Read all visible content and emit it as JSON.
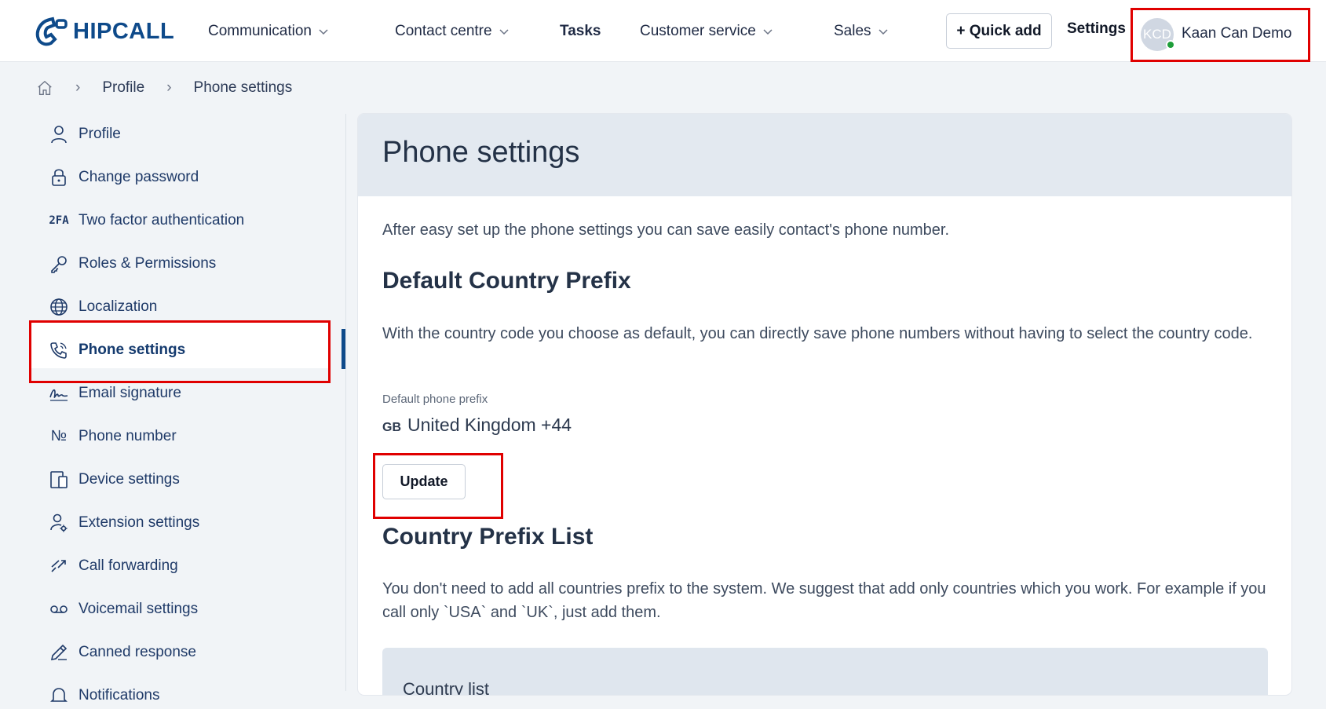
{
  "app": {
    "logo_text": "HIPCALL"
  },
  "nav": {
    "items": [
      {
        "label": "Communication",
        "has_dropdown": true
      },
      {
        "label": "Contact centre",
        "has_dropdown": true
      },
      {
        "label": "Tasks",
        "has_dropdown": false
      },
      {
        "label": "Customer service",
        "has_dropdown": true
      },
      {
        "label": "Sales",
        "has_dropdown": true
      }
    ],
    "quick_add": "+ Quick add",
    "settings": "Settings",
    "user": {
      "initials": "KCD",
      "name": "Kaan Can Demo",
      "status_color": "#1e9e3a"
    }
  },
  "breadcrumb": {
    "items": [
      "Profile",
      "Phone settings"
    ]
  },
  "sidebar": {
    "items": [
      {
        "label": "Profile",
        "icon": "user-icon"
      },
      {
        "label": "Change password",
        "icon": "lock-icon"
      },
      {
        "label": "Two factor authentication",
        "icon": "2fa-icon",
        "icon_text": "2FA"
      },
      {
        "label": "Roles & Permissions",
        "icon": "key-icon"
      },
      {
        "label": "Localization",
        "icon": "globe-icon"
      },
      {
        "label": "Phone settings",
        "icon": "phone-icon",
        "active": true
      },
      {
        "label": "Email signature",
        "icon": "signature-icon"
      },
      {
        "label": "Phone number",
        "icon": "numero-icon",
        "icon_text": "№"
      },
      {
        "label": "Device settings",
        "icon": "devices-icon"
      },
      {
        "label": "Extension settings",
        "icon": "user-gear-icon"
      },
      {
        "label": "Call forwarding",
        "icon": "forward-icon"
      },
      {
        "label": "Voicemail settings",
        "icon": "voicemail-icon"
      },
      {
        "label": "Canned response",
        "icon": "pen-icon"
      },
      {
        "label": "Notifications",
        "icon": "bell-icon"
      }
    ]
  },
  "main": {
    "title": "Phone settings",
    "intro": "After easy set up the phone settings you can save easily contact's phone number.",
    "default_prefix": {
      "heading": "Default Country Prefix",
      "description": "With the country code you choose as default, you can directly save phone numbers without having to select the country code.",
      "field_label": "Default phone prefix",
      "country_code": "GB",
      "value": "United Kingdom +44",
      "update_label": "Update"
    },
    "prefix_list": {
      "heading": "Country Prefix List",
      "description": "You don't need to add all countries prefix to the system. We suggest that add only countries which you work. For example if you call only `USA` and `UK`, just add them.",
      "country_list_label": "Country list"
    }
  },
  "colors": {
    "brand": "#0e4a8a",
    "highlight": "#e00000"
  }
}
